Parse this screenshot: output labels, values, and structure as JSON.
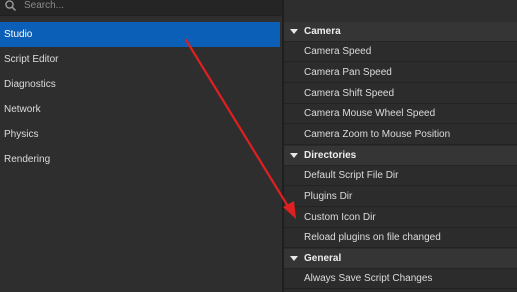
{
  "search": {
    "placeholder": "Search..."
  },
  "sidebar": {
    "items": [
      {
        "label": "Studio",
        "selected": true
      },
      {
        "label": "Script Editor"
      },
      {
        "label": "Diagnostics"
      },
      {
        "label": "Network"
      },
      {
        "label": "Physics"
      },
      {
        "label": "Rendering"
      }
    ]
  },
  "panel": {
    "sections": [
      {
        "title": "Camera",
        "items": [
          "Camera Speed",
          "Camera Pan Speed",
          "Camera Shift Speed",
          "Camera Mouse Wheel Speed",
          "Camera Zoom to Mouse Position"
        ]
      },
      {
        "title": "Directories",
        "items": [
          "Default Script File Dir",
          "Plugins Dir",
          "Custom Icon Dir",
          "Reload plugins on file changed"
        ]
      },
      {
        "title": "General",
        "items": [
          "Always Save Script Changes"
        ]
      }
    ]
  },
  "colors": {
    "selected": "#0b5fb7",
    "annotation_arrow": "#e02020"
  }
}
